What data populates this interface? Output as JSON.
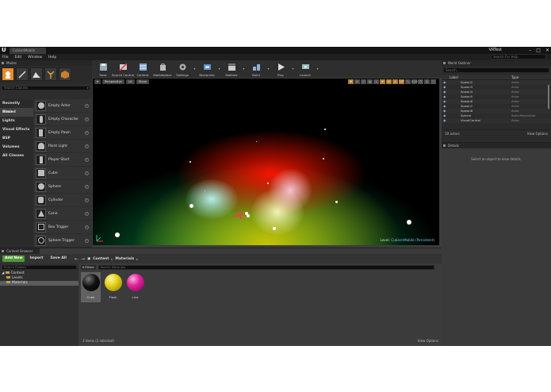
{
  "window": {
    "doc_tab": "CubismMobile",
    "project_name": "VRTest",
    "search_help_placeholder": "Search For Help",
    "minimize": "–",
    "maximize": "□",
    "close": "✕"
  },
  "menu": [
    "File",
    "Edit",
    "Window",
    "Help"
  ],
  "modes": {
    "tab_label": "Modes",
    "search_placeholder": "Search Classes",
    "categories": [
      "Recently Placed",
      "Basic",
      "Lights",
      "Visual Effects",
      "BSP",
      "Volumes",
      "All Classes"
    ],
    "active_category": "Basic",
    "items": [
      "Empty Actor",
      "Empty Character",
      "Empty Pawn",
      "Point Light",
      "Player Start",
      "Cube",
      "Sphere",
      "Cylinder",
      "Cone",
      "Box Trigger",
      "Sphere Trigger"
    ]
  },
  "toolbar": {
    "buttons": [
      "Save",
      "Source Control",
      "Content",
      "Marketplace",
      "Settings",
      "Blueprints",
      "Matinee",
      "Build",
      "Play",
      "Launch"
    ],
    "accent": "#e58b2c"
  },
  "viewport": {
    "perspective": "Perspective",
    "lit": "Lit",
    "show": "Show",
    "right_buttons": [
      "10",
      "10°",
      "0.25",
      "4"
    ],
    "level_prefix": "Level:",
    "level_name": "CubismMobile (Persistent)"
  },
  "outliner": {
    "tab_label": "World Outliner",
    "search_placeholder": "Search...",
    "col_label": "Label",
    "col_type": "Type",
    "rows": [
      {
        "name": "Spawn2",
        "type": "Actor"
      },
      {
        "name": "Spawn3",
        "type": "Actor"
      },
      {
        "name": "Spawn4",
        "type": "Actor"
      },
      {
        "name": "Spawn5",
        "type": "Actor"
      },
      {
        "name": "Spawn6",
        "type": "Actor"
      },
      {
        "name": "Spawn7",
        "type": "Actor"
      },
      {
        "name": "Spawn8",
        "type": "Actor"
      },
      {
        "name": "Sphere",
        "type": "StaticMeshActor"
      },
      {
        "name": "VisualControl",
        "type": "Actor"
      }
    ],
    "count": "19 actors",
    "view_options": "View Options"
  },
  "details": {
    "tab_label": "Details",
    "empty_message": "Select an object to view details."
  },
  "content_browser": {
    "tab_label": "Content Browser",
    "add_new": "Add New",
    "import": "Import",
    "save_all": "Save All",
    "path": [
      "Content",
      "Materials"
    ],
    "search_folders_placeholder": "Search Folders",
    "tree": [
      "Content",
      "Levels",
      "Materials"
    ],
    "filters": "Filters",
    "search_placeholder": "Search Materials",
    "assets": [
      {
        "name": "Cube",
        "color": "#111111"
      },
      {
        "name": "Flash",
        "color": "#e7d11b"
      },
      {
        "name": "Line",
        "color": "#e0259a"
      }
    ],
    "status": "3 items (1 selected)",
    "view_options": "View Options"
  }
}
